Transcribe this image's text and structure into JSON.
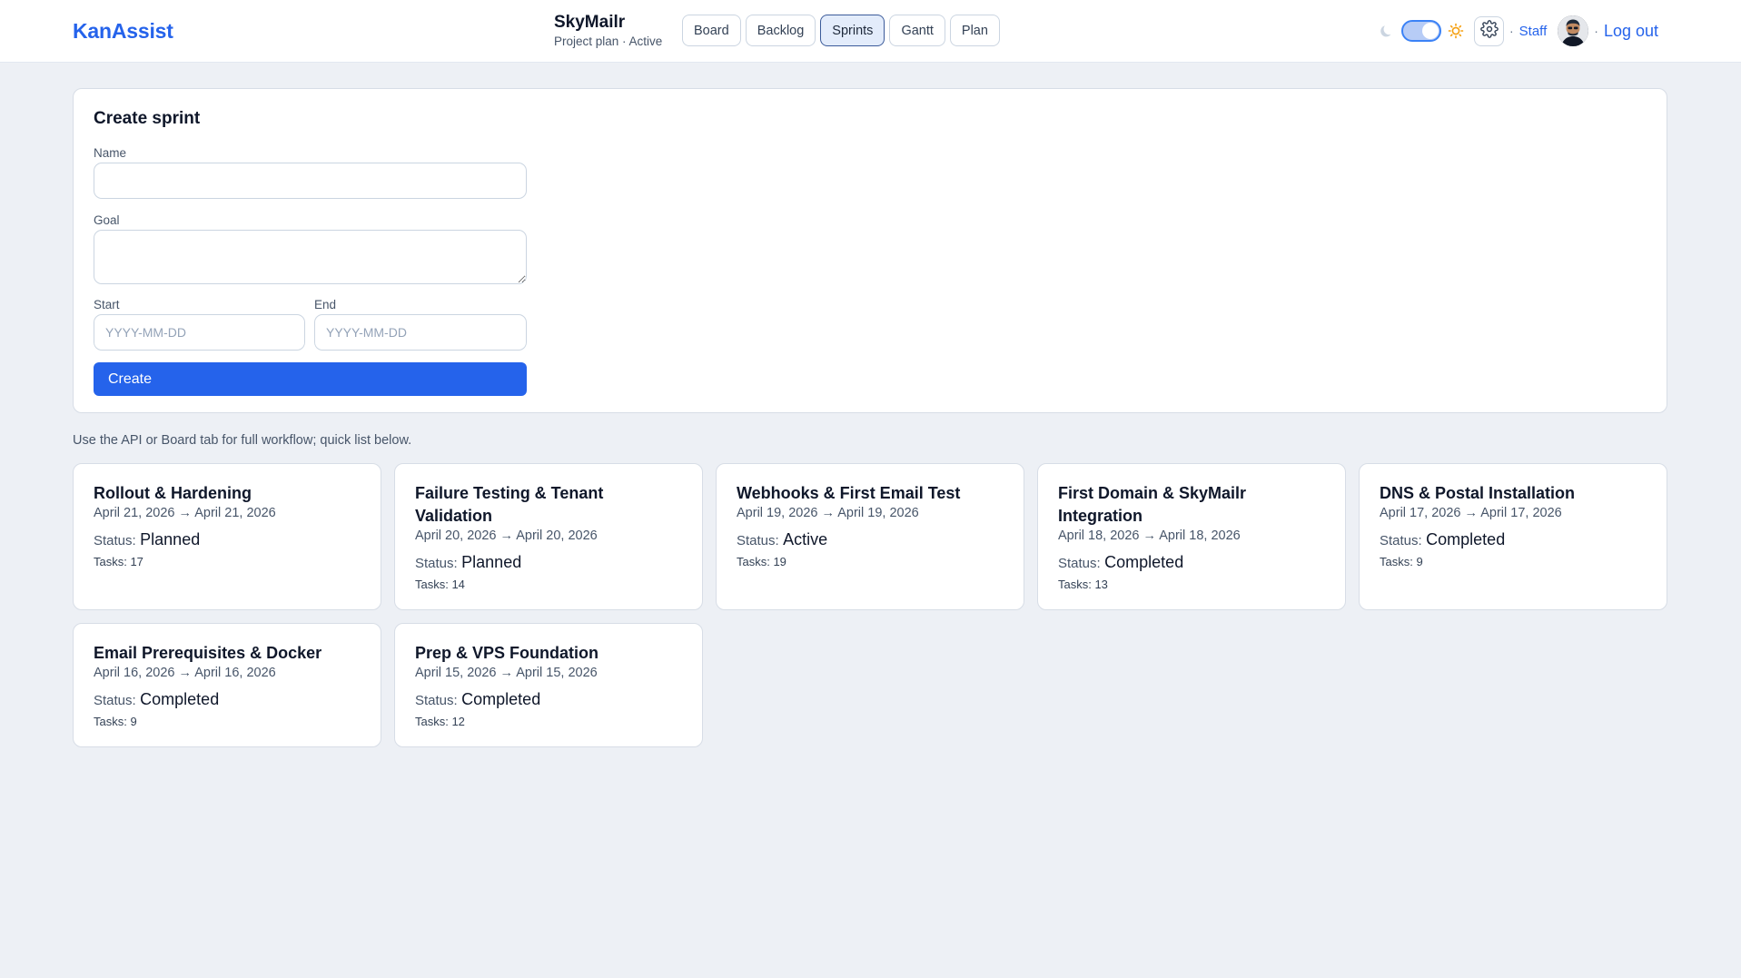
{
  "app": {
    "brand": "KanAssist"
  },
  "project": {
    "name": "SkyMailr",
    "subtitle": "Project plan · Active"
  },
  "tabs": [
    {
      "label": "Board",
      "active": false
    },
    {
      "label": "Backlog",
      "active": false
    },
    {
      "label": "Sprints",
      "active": true
    },
    {
      "label": "Gantt",
      "active": false
    },
    {
      "label": "Plan",
      "active": false
    }
  ],
  "user_bar": {
    "theme_toggle": "light",
    "sep": "·",
    "staff_label": "Staff",
    "logout_label": "Log out"
  },
  "create_form": {
    "title": "Create sprint",
    "name_label": "Name",
    "name_value": "",
    "goal_label": "Goal",
    "goal_value": "",
    "start_label": "Start",
    "start_placeholder": "YYYY-MM-DD",
    "end_label": "End",
    "end_placeholder": "YYYY-MM-DD",
    "submit_label": "Create"
  },
  "note": "Use the API or Board tab for full workflow; quick list below.",
  "sprints": [
    {
      "name": "Rollout & Hardening",
      "dates": "April 21, 2026 → April 21, 2026",
      "status_label": "Status:",
      "status": "Planned",
      "tasks": "Tasks: 17"
    },
    {
      "name": "Failure Testing & Tenant Validation",
      "dates": "April 20, 2026 → April 20, 2026",
      "status_label": "Status:",
      "status": "Planned",
      "tasks": "Tasks: 14"
    },
    {
      "name": "Webhooks & First Email Test",
      "dates": "April 19, 2026 → April 19, 2026",
      "status_label": "Status:",
      "status": "Active",
      "tasks": "Tasks: 19"
    },
    {
      "name": "First Domain & SkyMailr Integration",
      "dates": "April 18, 2026 → April 18, 2026",
      "status_label": "Status:",
      "status": "Completed",
      "tasks": "Tasks: 13"
    },
    {
      "name": "DNS & Postal Installation",
      "dates": "April 17, 2026 → April 17, 2026",
      "status_label": "Status:",
      "status": "Completed",
      "tasks": "Tasks: 9"
    },
    {
      "name": "Email Prerequisites & Docker",
      "dates": "April 16, 2026 → April 16, 2026",
      "status_label": "Status:",
      "status": "Completed",
      "tasks": "Tasks: 9"
    },
    {
      "name": "Prep & VPS Foundation",
      "dates": "April 15, 2026 → April 15, 2026",
      "status_label": "Status:",
      "status": "Completed",
      "tasks": "Tasks: 12"
    }
  ],
  "colors": {
    "accent": "#2563eb",
    "background": "#edf0f5",
    "card": "#ffffff"
  },
  "icons": {
    "moon": "moon-icon",
    "sun": "sun-icon",
    "settings": "gear-icon",
    "avatar": "avatar"
  }
}
